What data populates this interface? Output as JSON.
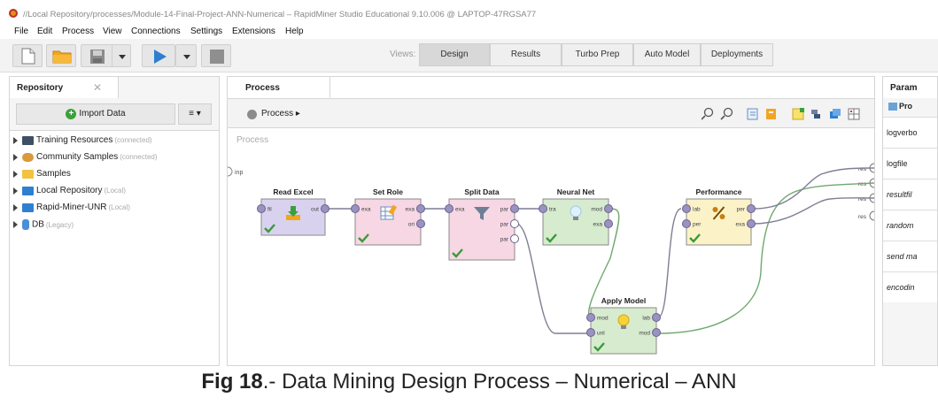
{
  "window": {
    "title": "//Local Repository/processes/Module-14-Final-Project-ANN-Numerical – RapidMiner Studio Educational 9.10.006 @ LAPTOP-47RGSA77"
  },
  "menu": [
    "File",
    "Edit",
    "Process",
    "View",
    "Connections",
    "Settings",
    "Extensions",
    "Help"
  ],
  "toolbar": {
    "views_label": "Views:",
    "view_tabs": [
      "Design",
      "Results",
      "Turbo Prep",
      "Auto Model",
      "Deployments"
    ],
    "active_view": "Design"
  },
  "repository": {
    "tab_label": "Repository",
    "import_label": "Import Data",
    "menu_label": "≡ ▾",
    "items": [
      {
        "name": "Training Resources",
        "status": "(connected)",
        "icon_color": "#3d4f63"
      },
      {
        "name": "Community Samples",
        "status": "(connected)",
        "icon_color": "#d99a3a"
      },
      {
        "name": "Samples",
        "status": "",
        "icon_color": "#f2c240"
      },
      {
        "name": "Local Repository",
        "status": "(Local)",
        "icon_color": "#2f7fd0"
      },
      {
        "name": "Rapid-Miner-UNR",
        "status": "(Local)",
        "icon_color": "#2f7fd0"
      },
      {
        "name": "DB",
        "status": "(Legacy)",
        "icon_color": "#4a90d9"
      }
    ]
  },
  "process": {
    "tab_label": "Process",
    "breadcrumb": "Process ▸",
    "canvas_label": "Process",
    "input_port": "inp",
    "operators": [
      {
        "name": "Read Excel",
        "in_ports": [
          "fil"
        ],
        "out_ports": [
          "out"
        ],
        "color": "#d9d2ef"
      },
      {
        "name": "Set Role",
        "in_ports": [
          "exa"
        ],
        "out_ports": [
          "exa",
          "ori"
        ],
        "color": "#f6d7e3"
      },
      {
        "name": "Split Data",
        "in_ports": [
          "exa"
        ],
        "out_ports": [
          "par",
          "par",
          "par"
        ],
        "color": "#f6d7e3"
      },
      {
        "name": "Neural Net",
        "in_ports": [
          "tra"
        ],
        "out_ports": [
          "mod",
          "exa"
        ],
        "color": "#d7ebcf"
      },
      {
        "name": "Performance",
        "in_ports": [
          "lab",
          "per"
        ],
        "out_ports": [
          "per",
          "exa"
        ],
        "color": "#fbf2c8"
      },
      {
        "name": "Apply Model",
        "in_ports": [
          "mod",
          "unl"
        ],
        "out_ports": [
          "lab",
          "mod"
        ],
        "color": "#d7ebcf"
      }
    ],
    "result_ports": [
      "res",
      "res",
      "res",
      "res"
    ]
  },
  "parameters": {
    "tab_label": "Param",
    "operator_label": "Pro",
    "rows": [
      {
        "label": "logverbo",
        "italic": false
      },
      {
        "label": "logfile",
        "italic": false
      },
      {
        "label": "resultfil",
        "italic": true
      },
      {
        "label": "random",
        "italic": true
      },
      {
        "label": "send ma",
        "italic": true
      },
      {
        "label": "encodin",
        "italic": true
      }
    ]
  },
  "caption": {
    "bold": "Fig 18",
    "rest": ".- Data Mining Design Process – Numerical – ANN"
  },
  "colors": {
    "port": "#9a92c0",
    "wire": "#7f7f95",
    "wire_model": "#6fa86f",
    "check": "#3a9a3a"
  }
}
